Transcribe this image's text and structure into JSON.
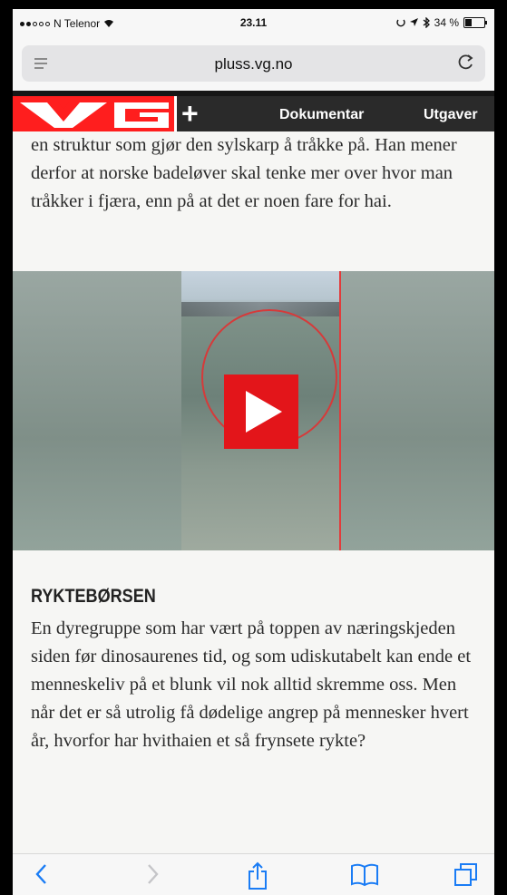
{
  "status_bar": {
    "carrier": "N Telenor",
    "time": "23.11",
    "battery": "34 %",
    "battery_level": 0.34
  },
  "browser": {
    "url": "pluss.vg.no"
  },
  "site_header": {
    "logo": "VG",
    "plus": "+",
    "nav": [
      "Dokumentar",
      "Utgaver"
    ]
  },
  "article": {
    "paragraph_top": "en struktur som gjør den sylskarp å tråkke på. Han mener derfor at norske badeløver skal tenke mer over hvor man tråkker i fjæra, enn på at det er noen fare for hai.",
    "section_heading": "RYKTEBØRSEN",
    "paragraph_bottom": "En dyregruppe som har vært på toppen av næringskjeden siden før dinosaurenes tid, og som udiskutabelt kan ende et menneskeliv på et blunk vil nok alltid skremme oss. Men når det er så utrolig få dødelige angrep på mennesker hvert år, hvorfor har hvithaien et så frynsete rykte?"
  },
  "toolbar": {
    "icons": [
      "back-icon",
      "forward-icon",
      "share-icon",
      "bookmarks-icon",
      "tabs-icon"
    ]
  },
  "colors": {
    "vg_red": "#ff1e1e",
    "header_dark": "#2a2a2a",
    "ios_blue": "#1a7cf5",
    "play_red": "#e3151a"
  }
}
